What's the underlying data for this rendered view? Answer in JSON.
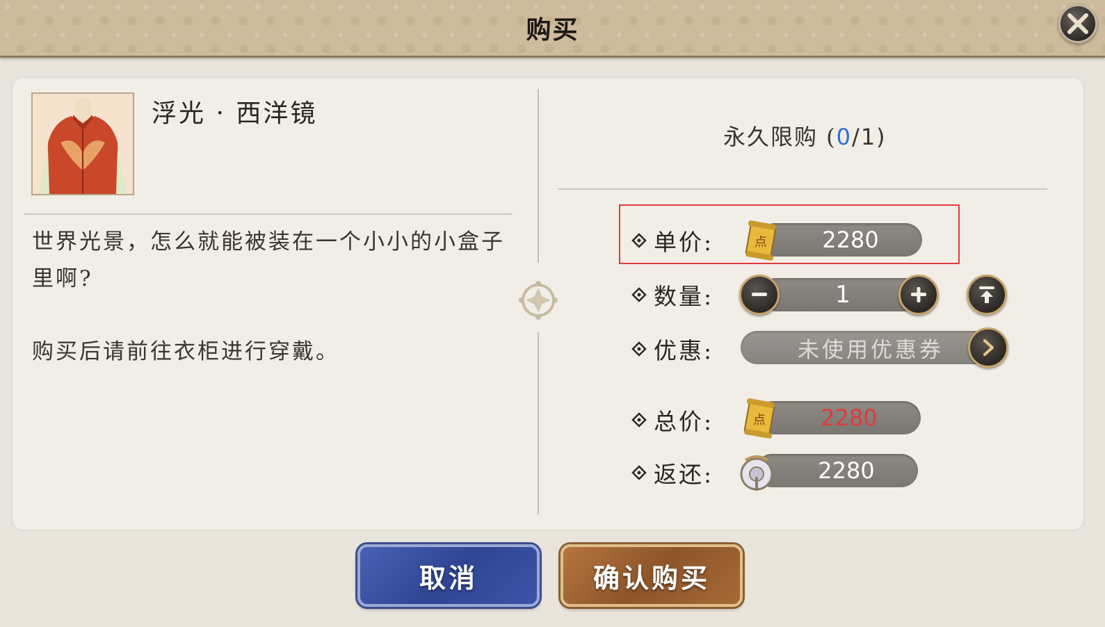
{
  "header": {
    "title": "购买"
  },
  "item": {
    "name": "浮光 · 西洋镜",
    "description": "世界光景，怎么就能被装在一个小小的小盒子里啊?",
    "note": "购买后请前往衣柜进行穿戴。"
  },
  "limit": {
    "label": "永久限购 (",
    "current": "0",
    "max": "/1)"
  },
  "rows": {
    "unit_price": {
      "label": "单价:",
      "value": "2280"
    },
    "quantity": {
      "label": "数量:",
      "value": "1"
    },
    "discount": {
      "label": "优惠:",
      "value": "未使用优惠券"
    },
    "total": {
      "label": "总价:",
      "value": "2280"
    },
    "refund": {
      "label": "返还:",
      "value": "2280"
    }
  },
  "buttons": {
    "cancel": "取消",
    "confirm": "确认购买"
  },
  "colors": {
    "limit_current": "#2f6fd6",
    "total_value": "#e23a3a",
    "highlight": "#e03a3a"
  }
}
